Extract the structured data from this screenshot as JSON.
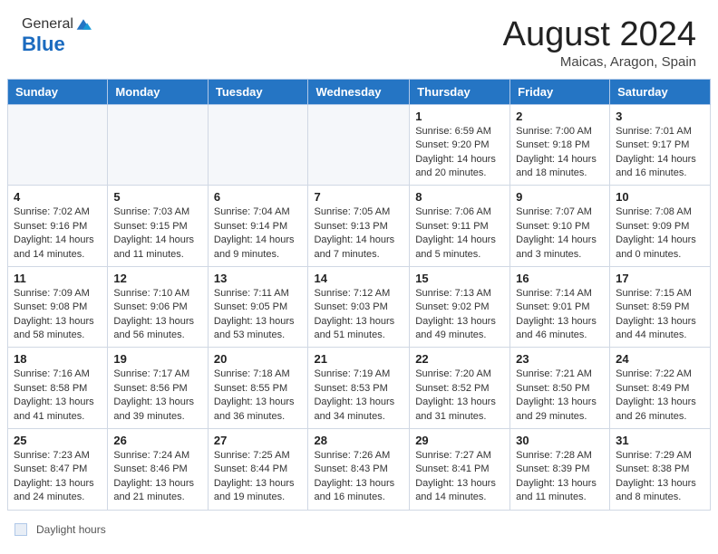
{
  "header": {
    "logo_general": "General",
    "logo_blue": "Blue",
    "month_year": "August 2024",
    "location": "Maicas, Aragon, Spain"
  },
  "days_of_week": [
    "Sunday",
    "Monday",
    "Tuesday",
    "Wednesday",
    "Thursday",
    "Friday",
    "Saturday"
  ],
  "weeks": [
    [
      {
        "day": "",
        "info": ""
      },
      {
        "day": "",
        "info": ""
      },
      {
        "day": "",
        "info": ""
      },
      {
        "day": "",
        "info": ""
      },
      {
        "day": "1",
        "info": "Sunrise: 6:59 AM\nSunset: 9:20 PM\nDaylight: 14 hours\nand 20 minutes."
      },
      {
        "day": "2",
        "info": "Sunrise: 7:00 AM\nSunset: 9:18 PM\nDaylight: 14 hours\nand 18 minutes."
      },
      {
        "day": "3",
        "info": "Sunrise: 7:01 AM\nSunset: 9:17 PM\nDaylight: 14 hours\nand 16 minutes."
      }
    ],
    [
      {
        "day": "4",
        "info": "Sunrise: 7:02 AM\nSunset: 9:16 PM\nDaylight: 14 hours\nand 14 minutes."
      },
      {
        "day": "5",
        "info": "Sunrise: 7:03 AM\nSunset: 9:15 PM\nDaylight: 14 hours\nand 11 minutes."
      },
      {
        "day": "6",
        "info": "Sunrise: 7:04 AM\nSunset: 9:14 PM\nDaylight: 14 hours\nand 9 minutes."
      },
      {
        "day": "7",
        "info": "Sunrise: 7:05 AM\nSunset: 9:13 PM\nDaylight: 14 hours\nand 7 minutes."
      },
      {
        "day": "8",
        "info": "Sunrise: 7:06 AM\nSunset: 9:11 PM\nDaylight: 14 hours\nand 5 minutes."
      },
      {
        "day": "9",
        "info": "Sunrise: 7:07 AM\nSunset: 9:10 PM\nDaylight: 14 hours\nand 3 minutes."
      },
      {
        "day": "10",
        "info": "Sunrise: 7:08 AM\nSunset: 9:09 PM\nDaylight: 14 hours\nand 0 minutes."
      }
    ],
    [
      {
        "day": "11",
        "info": "Sunrise: 7:09 AM\nSunset: 9:08 PM\nDaylight: 13 hours\nand 58 minutes."
      },
      {
        "day": "12",
        "info": "Sunrise: 7:10 AM\nSunset: 9:06 PM\nDaylight: 13 hours\nand 56 minutes."
      },
      {
        "day": "13",
        "info": "Sunrise: 7:11 AM\nSunset: 9:05 PM\nDaylight: 13 hours\nand 53 minutes."
      },
      {
        "day": "14",
        "info": "Sunrise: 7:12 AM\nSunset: 9:03 PM\nDaylight: 13 hours\nand 51 minutes."
      },
      {
        "day": "15",
        "info": "Sunrise: 7:13 AM\nSunset: 9:02 PM\nDaylight: 13 hours\nand 49 minutes."
      },
      {
        "day": "16",
        "info": "Sunrise: 7:14 AM\nSunset: 9:01 PM\nDaylight: 13 hours\nand 46 minutes."
      },
      {
        "day": "17",
        "info": "Sunrise: 7:15 AM\nSunset: 8:59 PM\nDaylight: 13 hours\nand 44 minutes."
      }
    ],
    [
      {
        "day": "18",
        "info": "Sunrise: 7:16 AM\nSunset: 8:58 PM\nDaylight: 13 hours\nand 41 minutes."
      },
      {
        "day": "19",
        "info": "Sunrise: 7:17 AM\nSunset: 8:56 PM\nDaylight: 13 hours\nand 39 minutes."
      },
      {
        "day": "20",
        "info": "Sunrise: 7:18 AM\nSunset: 8:55 PM\nDaylight: 13 hours\nand 36 minutes."
      },
      {
        "day": "21",
        "info": "Sunrise: 7:19 AM\nSunset: 8:53 PM\nDaylight: 13 hours\nand 34 minutes."
      },
      {
        "day": "22",
        "info": "Sunrise: 7:20 AM\nSunset: 8:52 PM\nDaylight: 13 hours\nand 31 minutes."
      },
      {
        "day": "23",
        "info": "Sunrise: 7:21 AM\nSunset: 8:50 PM\nDaylight: 13 hours\nand 29 minutes."
      },
      {
        "day": "24",
        "info": "Sunrise: 7:22 AM\nSunset: 8:49 PM\nDaylight: 13 hours\nand 26 minutes."
      }
    ],
    [
      {
        "day": "25",
        "info": "Sunrise: 7:23 AM\nSunset: 8:47 PM\nDaylight: 13 hours\nand 24 minutes."
      },
      {
        "day": "26",
        "info": "Sunrise: 7:24 AM\nSunset: 8:46 PM\nDaylight: 13 hours\nand 21 minutes."
      },
      {
        "day": "27",
        "info": "Sunrise: 7:25 AM\nSunset: 8:44 PM\nDaylight: 13 hours\nand 19 minutes."
      },
      {
        "day": "28",
        "info": "Sunrise: 7:26 AM\nSunset: 8:43 PM\nDaylight: 13 hours\nand 16 minutes."
      },
      {
        "day": "29",
        "info": "Sunrise: 7:27 AM\nSunset: 8:41 PM\nDaylight: 13 hours\nand 14 minutes."
      },
      {
        "day": "30",
        "info": "Sunrise: 7:28 AM\nSunset: 8:39 PM\nDaylight: 13 hours\nand 11 minutes."
      },
      {
        "day": "31",
        "info": "Sunrise: 7:29 AM\nSunset: 8:38 PM\nDaylight: 13 hours\nand 8 minutes."
      }
    ]
  ],
  "footer": {
    "note_label": "Daylight hours"
  }
}
